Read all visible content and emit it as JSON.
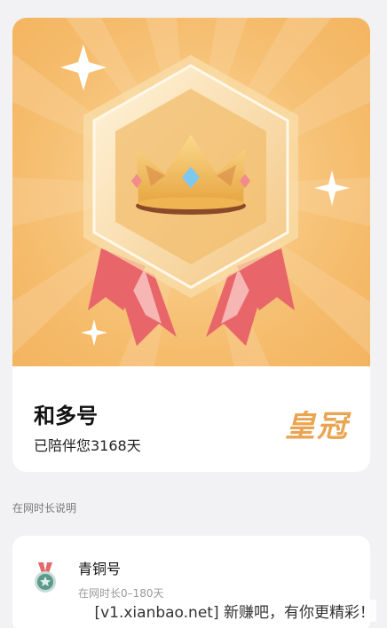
{
  "header": {
    "nickname": "和多号",
    "accompany_text": "已陪伴您3168天",
    "level_label": "皇冠",
    "level_color": "#e9a552",
    "banner_color": "#f7c276"
  },
  "badge_icon": "crown-medal-icon",
  "section": {
    "title": "在网时长说明"
  },
  "levels": [
    {
      "name": "青铜号",
      "range": "在网时长0–180天",
      "icon": "bronze-medal-icon"
    }
  ],
  "watermark": "[v1.xianbao.net] 新赚吧，有你更精彩！"
}
